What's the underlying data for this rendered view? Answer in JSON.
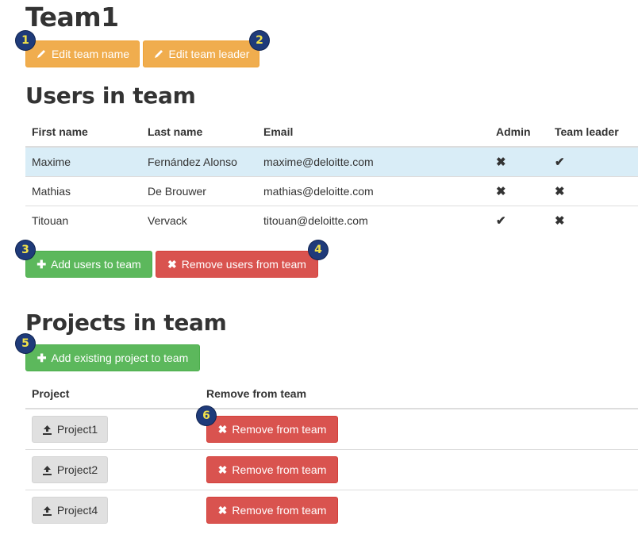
{
  "team": {
    "title": "Team1",
    "edit_name_label": "Edit team name",
    "edit_leader_label": "Edit team leader"
  },
  "users": {
    "heading": "Users in team",
    "columns": [
      "First name",
      "Last name",
      "Email",
      "Admin",
      "Team leader"
    ],
    "rows": [
      {
        "first": "Maxime",
        "last": "Fernández Alonso",
        "email": "maxime@deloitte.com",
        "admin": "✖",
        "leader": "✔"
      },
      {
        "first": "Mathias",
        "last": "De Brouwer",
        "email": "mathias@deloitte.com",
        "admin": "✖",
        "leader": "✖"
      },
      {
        "first": "Titouan",
        "last": "Vervack",
        "email": "titouan@deloitte.com",
        "admin": "✔",
        "leader": "✖"
      }
    ],
    "add_label": "Add users to team",
    "remove_label": "Remove users from team"
  },
  "projects": {
    "heading": "Projects in team",
    "add_existing_label": "Add existing project to team",
    "columns": [
      "Project",
      "Remove from team"
    ],
    "rows": [
      {
        "name": "Project1",
        "remove_label": "Remove from team"
      },
      {
        "name": "Project2",
        "remove_label": "Remove from team"
      },
      {
        "name": "Project4",
        "remove_label": "Remove from team"
      }
    ]
  },
  "badges": [
    "1",
    "2",
    "3",
    "4",
    "5",
    "6"
  ],
  "icons": {
    "edit": "pencil-icon",
    "add": "plus-icon",
    "remove": "remove-icon",
    "project": "upload-icon",
    "yes": "check-icon",
    "no": "cross-icon"
  },
  "colors": {
    "warning": "#f0ad4e",
    "success": "#5cb85c",
    "danger": "#d9534f",
    "highlight_row": "#d9edf7",
    "badge": "#1f3b7a"
  }
}
